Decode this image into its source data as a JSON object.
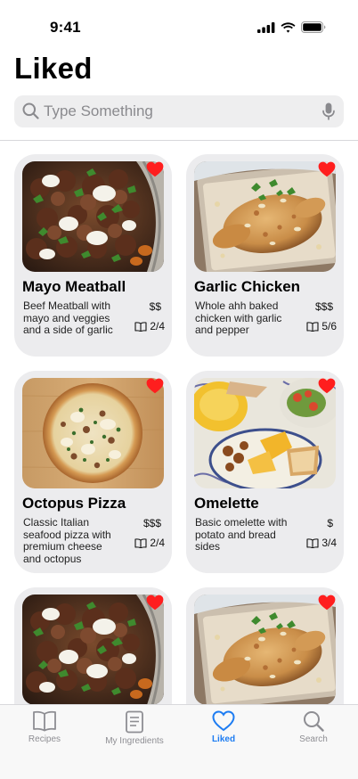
{
  "status_bar": {
    "time": "9:41"
  },
  "page": {
    "title": "Liked"
  },
  "search": {
    "placeholder": "Type Something"
  },
  "recipes": [
    {
      "name": "Mayo Meatball",
      "description": "Beef Meatball with mayo and veggies and a side of garlic",
      "price": "$$",
      "ingredients": "2/4",
      "liked": true,
      "image": "meatball"
    },
    {
      "name": "Garlic Chicken",
      "description": "Whole ahh baked chicken with garlic and pepper",
      "price": "$$$",
      "ingredients": "5/6",
      "liked": true,
      "image": "chicken"
    },
    {
      "name": "Octopus Pizza",
      "description": "Classic Italian seafood pizza with premium cheese and octopus",
      "price": "$$$",
      "ingredients": "2/4",
      "liked": true,
      "image": "pizza"
    },
    {
      "name": "Omelette",
      "description": "Basic omelette with potato and bread sides",
      "price": "$",
      "ingredients": "3/4",
      "liked": true,
      "image": "omelette"
    },
    {
      "name": "",
      "description": "",
      "price": "",
      "ingredients": "",
      "liked": true,
      "image": "meatball"
    },
    {
      "name": "",
      "description": "",
      "price": "",
      "ingredients": "",
      "liked": true,
      "image": "chicken"
    }
  ],
  "tabs": [
    {
      "label": "Recipes",
      "icon": "book-icon",
      "active": false
    },
    {
      "label": "My Ingredients",
      "icon": "document-icon",
      "active": false
    },
    {
      "label": "Liked",
      "icon": "heart-icon",
      "active": true
    },
    {
      "label": "Search",
      "icon": "magnifier-icon",
      "active": false
    }
  ],
  "colors": {
    "accent": "#1d7cf2",
    "heart": "#ff1e1e",
    "card": "#ececee"
  }
}
